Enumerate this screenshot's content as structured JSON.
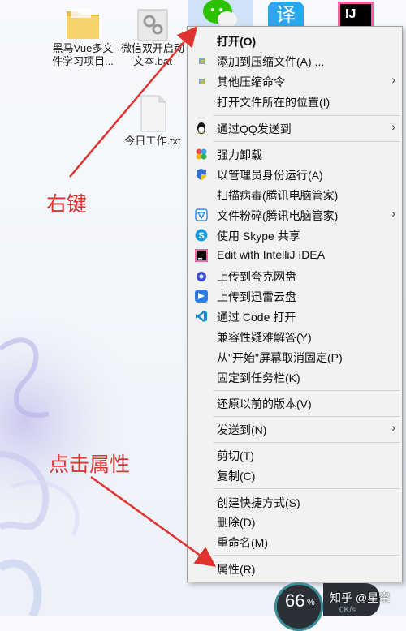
{
  "desktop": {
    "icons": [
      {
        "label_line1": "黑马Vue多文",
        "label_line2": "件学习项目..."
      },
      {
        "label_line1": "微信双开启动",
        "label_line2": "文本.bat"
      },
      {
        "label_line1": "今日工作.txt",
        "label_line2": ""
      }
    ],
    "top_icons": [
      {
        "name": "wechat-icon"
      },
      {
        "name": "tongyi-icon",
        "glyph": "译"
      },
      {
        "name": "intellij-icon",
        "glyph": "IJ"
      }
    ]
  },
  "annotations": {
    "right_click": "右键",
    "click_properties": "点击属性"
  },
  "context_menu": {
    "items": [
      {
        "label": "打开(O)",
        "bold": true
      },
      {
        "label": "添加到压缩文件(A) ..."
      },
      {
        "label": "其他压缩命令",
        "submenu": true
      },
      {
        "label": "打开文件所在的位置(I)"
      },
      {
        "label": "通过QQ发送到",
        "submenu": true
      },
      {
        "label": "强力卸载"
      },
      {
        "label": "以管理员身份运行(A)"
      },
      {
        "label": "扫描病毒(腾讯电脑管家)"
      },
      {
        "label": "文件粉碎(腾讯电脑管家)",
        "submenu": true
      },
      {
        "label": "使用 Skype 共享"
      },
      {
        "label": "Edit with IntelliJ IDEA"
      },
      {
        "label": "上传到夸克网盘"
      },
      {
        "label": "上传到迅雷云盘"
      },
      {
        "label": "通过 Code 打开"
      },
      {
        "label": "兼容性疑难解答(Y)"
      },
      {
        "label": "从\"开始\"屏幕取消固定(P)"
      },
      {
        "label": "固定到任务栏(K)"
      },
      {
        "label": "还原以前的版本(V)"
      },
      {
        "label": "发送到(N)",
        "submenu": true
      },
      {
        "label": "剪切(T)"
      },
      {
        "label": "复制(C)"
      },
      {
        "label": "创建快捷方式(S)"
      },
      {
        "label": "删除(D)"
      },
      {
        "label": "重命名(M)"
      },
      {
        "label": "属性(R)"
      }
    ],
    "submenu_arrow": "›"
  },
  "widgets": {
    "memory_percent": "66",
    "percent_sign": "%",
    "net_speed": "0K/s",
    "watermark": "知乎 @星空"
  },
  "colors": {
    "annotation_red": "#e0332f",
    "menu_bg": "#f2f2f2"
  }
}
